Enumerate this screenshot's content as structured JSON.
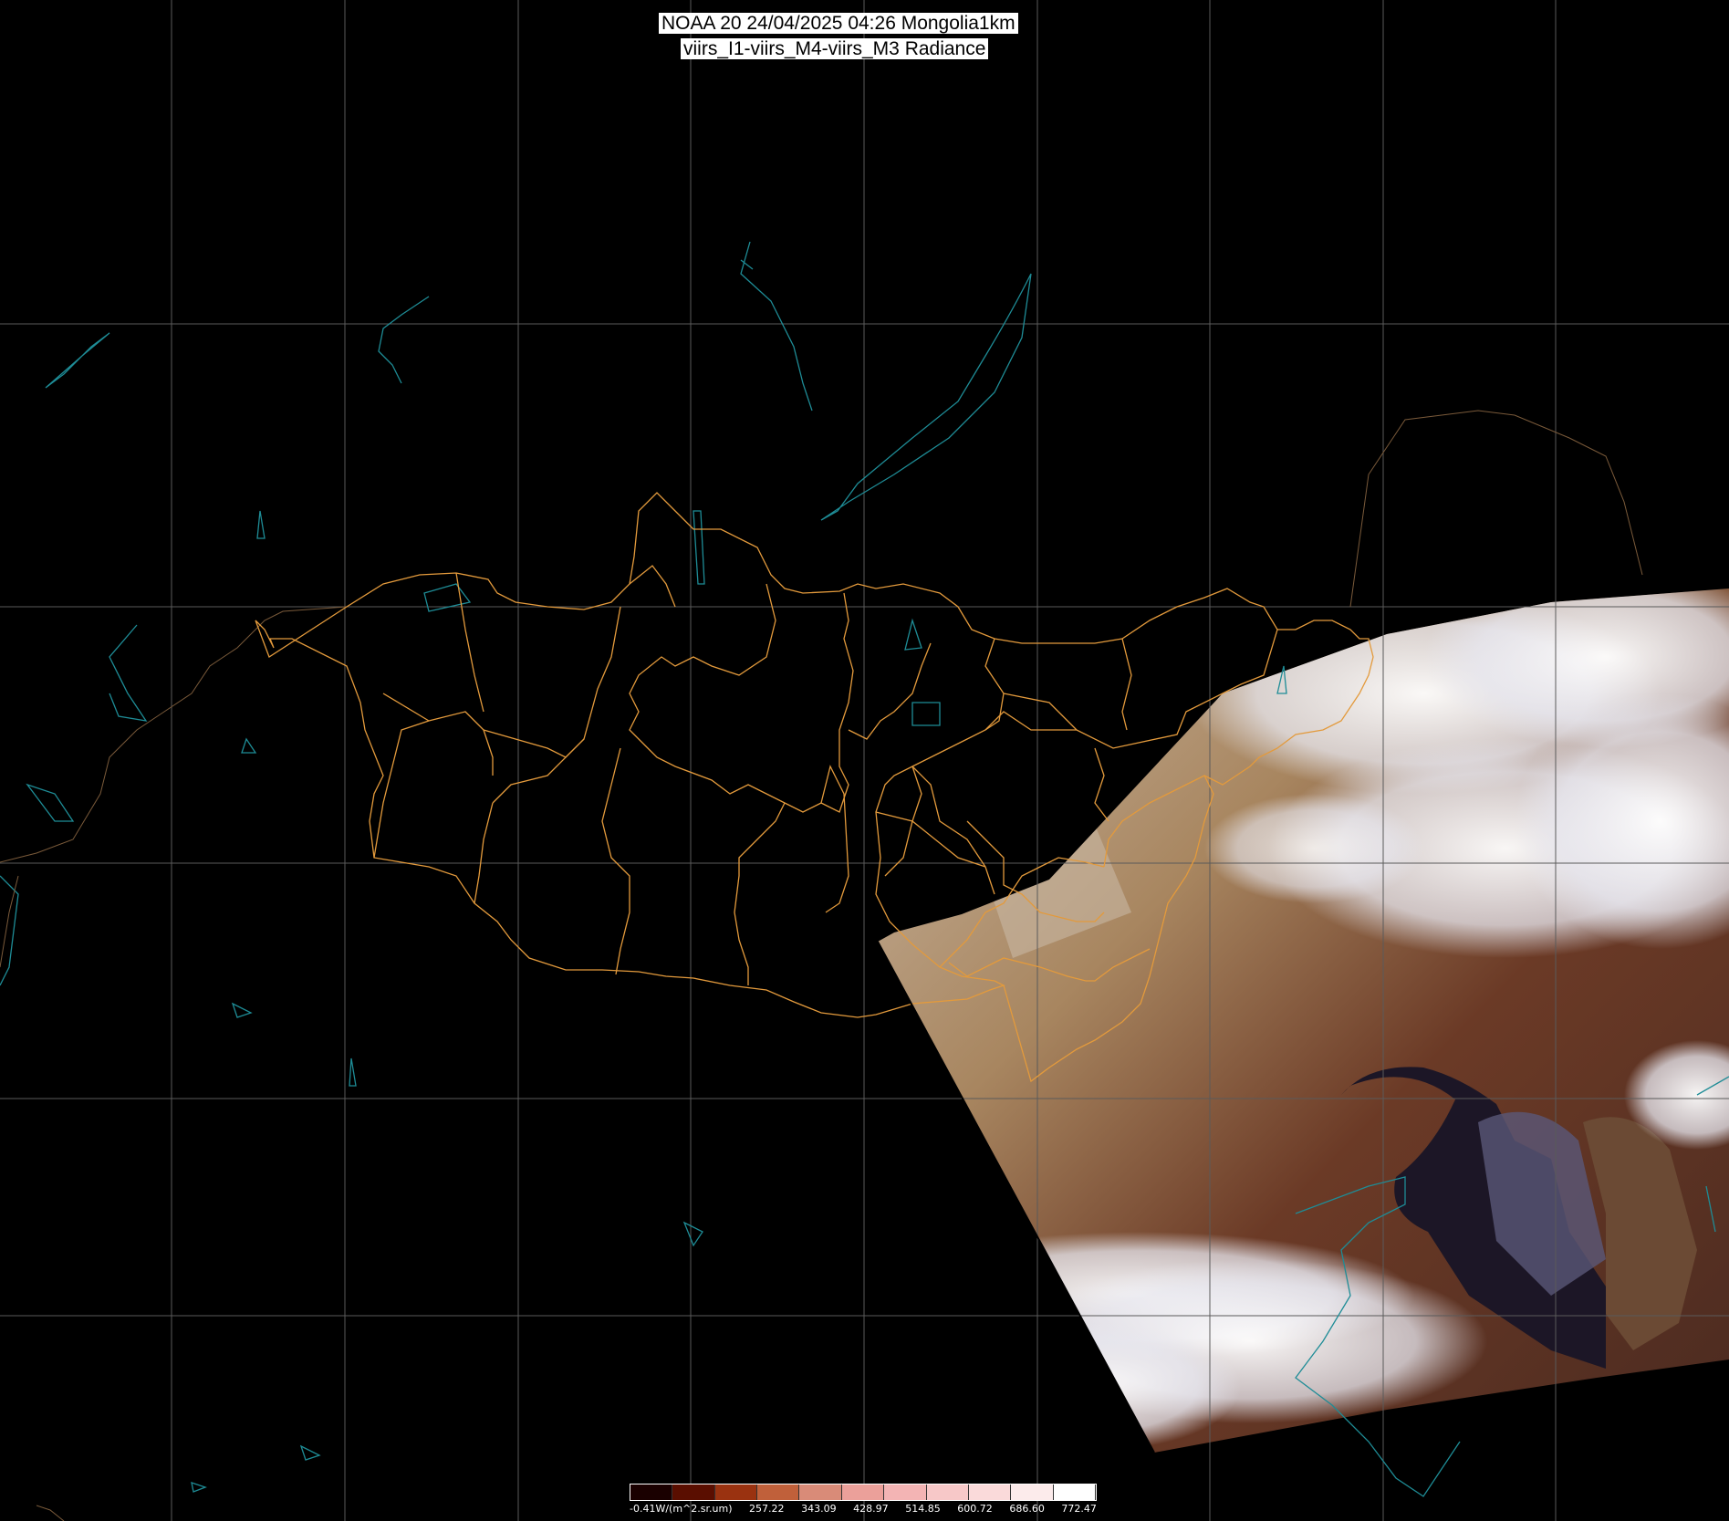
{
  "header": {
    "line1": "NOAA 20 24/04/2025 04:26 Mongolia1km",
    "line2": "viirs_I1-viirs_M4-viirs_M3 Radiance"
  },
  "colorbar": {
    "labels": [
      "-0.41W/(m^2.sr.um)",
      "257.22",
      "343.09",
      "428.97",
      "514.85",
      "600.72",
      "686.60",
      "772.47"
    ],
    "colors": [
      "#1a0000",
      "#5a0e00",
      "#9a3210",
      "#c0603a",
      "#d98b78",
      "#eba09a",
      "#f3b4b4",
      "#f7c8c8",
      "#fadada",
      "#fcebeb",
      "#ffffff"
    ]
  },
  "map": {
    "grid_color": "#5a5a5a",
    "border_color": "#e39a3c",
    "water_color": "#1e8c96"
  }
}
